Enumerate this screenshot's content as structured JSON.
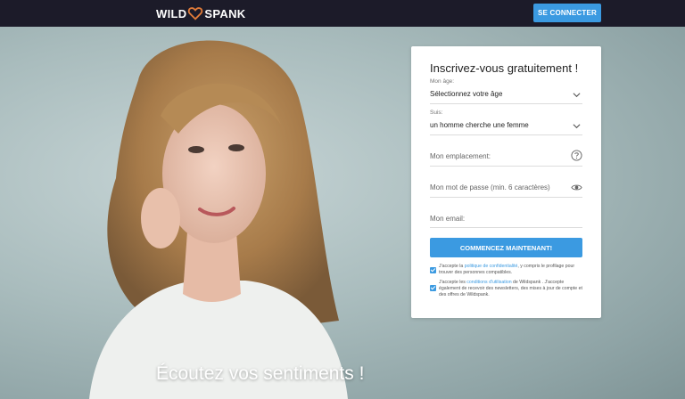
{
  "header": {
    "logo_left": "WILD",
    "logo_right": "SPANK",
    "connect_button": "SE CONNECTER"
  },
  "hero": {
    "headline": "Écoutez vos sentiments !"
  },
  "signup": {
    "title": "Inscrivez-vous gratuitement !",
    "age": {
      "label": "Mon âge:",
      "value": "Sélectionnez votre âge"
    },
    "suis": {
      "label": "Suis:",
      "value": "un homme cherche une femme"
    },
    "location_placeholder": "Mon emplacement:",
    "password_placeholder": "Mon mot de passe (min. 6 caractères)",
    "email_placeholder": "Mon email:",
    "submit": "COMMENCEZ MAINTENANT!",
    "consent1": {
      "pre": "J'accepte la ",
      "link": "politique de confidentialité",
      "post": ", y compris le profilage pour trouver des personnes compatibles."
    },
    "consent2": {
      "pre": "J'accepte les ",
      "link": "conditions d'utilisation",
      "post": " de Wildspank . J'accepte également de recevoir des newsletters, des mises à jour de compte et des offres de Wildspank."
    }
  },
  "colors": {
    "topbar": "#1c1b29",
    "accent": "#3b9ae1",
    "logo_heart": "#e07b39"
  }
}
